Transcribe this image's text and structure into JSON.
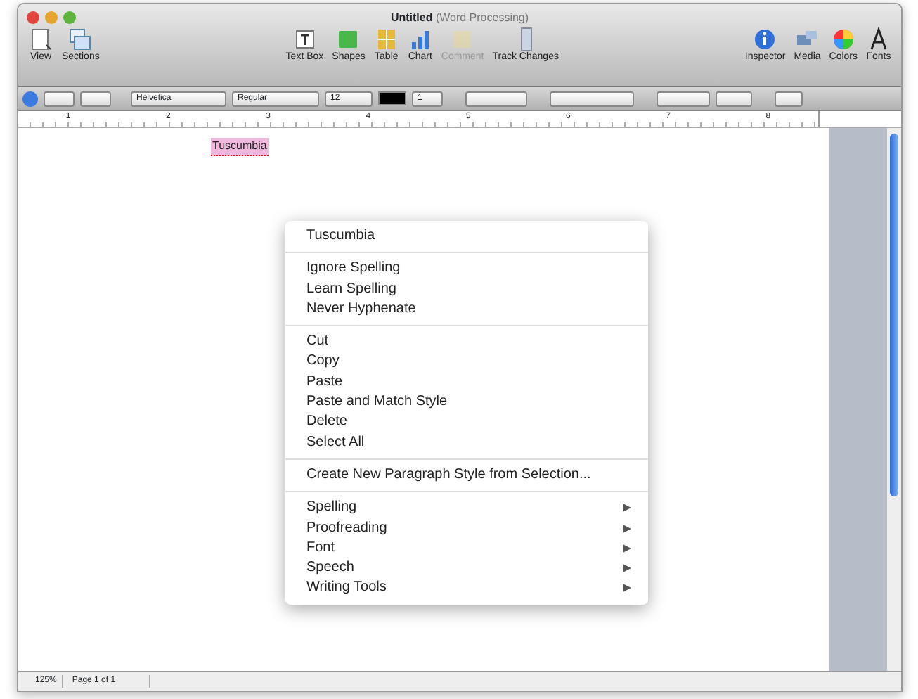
{
  "window": {
    "title": "Untitled",
    "subtitle": "(Word Processing)"
  },
  "toolbar": {
    "left": [
      {
        "label": "View",
        "kind": "view",
        "disabled": false
      },
      {
        "label": "Sections",
        "kind": "sections",
        "disabled": false
      }
    ],
    "center": [
      {
        "label": "Text Box",
        "kind": "textbox",
        "disabled": false
      },
      {
        "label": "Shapes",
        "kind": "shapes",
        "disabled": false
      },
      {
        "label": "Table",
        "kind": "table",
        "disabled": false
      },
      {
        "label": "Chart",
        "kind": "chart",
        "disabled": false
      },
      {
        "label": "Comment",
        "kind": "comment",
        "disabled": true
      },
      {
        "label": "Track Changes",
        "kind": "track",
        "disabled": false
      }
    ],
    "right": [
      {
        "label": "Inspector",
        "kind": "inspector",
        "disabled": false
      },
      {
        "label": "Media",
        "kind": "media",
        "disabled": false
      },
      {
        "label": "Colors",
        "kind": "colors",
        "disabled": false
      },
      {
        "label": "Fonts",
        "kind": "fonts",
        "disabled": false
      }
    ]
  },
  "format_bar": {
    "font": "Helvetica",
    "style": "Regular",
    "size": "12",
    "spacing": "1"
  },
  "ruler": {
    "labels": [
      "1",
      "2",
      "3",
      "4",
      "5",
      "6",
      "7",
      "8"
    ]
  },
  "document": {
    "word": "Tuscumbia",
    "misspelled": true
  },
  "context_menu": {
    "sections": [
      [
        {
          "label": "Tuscumbia",
          "submenu": false
        }
      ],
      [
        {
          "label": "Ignore Spelling",
          "submenu": false
        },
        {
          "label": "Learn Spelling",
          "submenu": false
        },
        {
          "label": "Never Hyphenate",
          "submenu": false
        }
      ],
      [
        {
          "label": "Cut",
          "submenu": false
        },
        {
          "label": "Copy",
          "submenu": false
        },
        {
          "label": "Paste",
          "submenu": false
        },
        {
          "label": "Paste and Match Style",
          "submenu": false
        },
        {
          "label": "Delete",
          "submenu": false
        },
        {
          "label": "Select All",
          "submenu": false
        }
      ],
      [
        {
          "label": "Create New Paragraph Style from Selection...",
          "submenu": false
        }
      ],
      [
        {
          "label": "Spelling",
          "submenu": true
        },
        {
          "label": "Proofreading",
          "submenu": true
        },
        {
          "label": "Font",
          "submenu": true
        },
        {
          "label": "Speech",
          "submenu": true
        },
        {
          "label": "Writing Tools",
          "submenu": true
        }
      ]
    ]
  },
  "status_bar": {
    "zoom": "125%",
    "page": "Page 1 of 1"
  }
}
